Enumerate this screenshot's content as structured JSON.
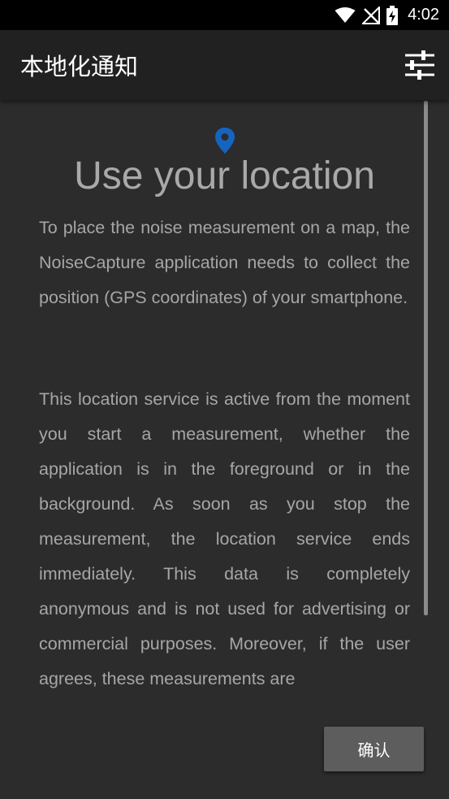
{
  "status_bar": {
    "time": "4:02",
    "icons": [
      "wifi-icon",
      "no-signal-icon",
      "battery-charging-icon"
    ]
  },
  "app_bar": {
    "title": "本地化通知",
    "settings_icon": "sliders-icon"
  },
  "content": {
    "location_icon": "map-pin-icon",
    "heading": "Use your location",
    "paragraph1": "To place the noise measurement on a map, the NoiseCapture application needs to collect the position (GPS coordinates) of your smartphone.",
    "paragraph2": "This location service is active from the moment you start a measurement, whether the application is in the foreground or in the background. As soon as you stop the measurement, the location service ends immediately. This data is completely anonymous and is not used for advertising or commercial purposes. Moreover, if the user agrees, these measurements are"
  },
  "actions": {
    "confirm_label": "确认"
  },
  "colors": {
    "background": "#2c2c2c",
    "app_bar": "#212121",
    "status_bar": "#000000",
    "pin": "#1565c0",
    "text": "#a6a6a6",
    "button": "#5d5d5d"
  }
}
